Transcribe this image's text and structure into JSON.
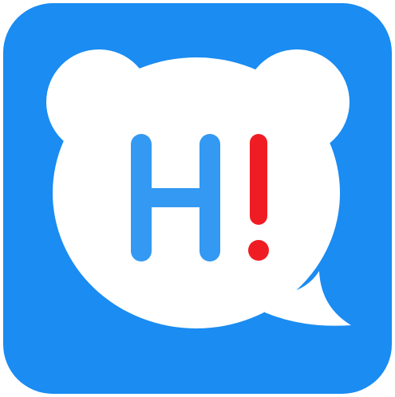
{
  "icon": {
    "name": "hi-bear-speech-bubble-icon",
    "background_color": "#1a8cf2",
    "bubble_color": "#ffffff",
    "letter_color": "#3399f2",
    "exclamation_color": "#f01c24",
    "letter": "H",
    "exclamation": "!"
  }
}
